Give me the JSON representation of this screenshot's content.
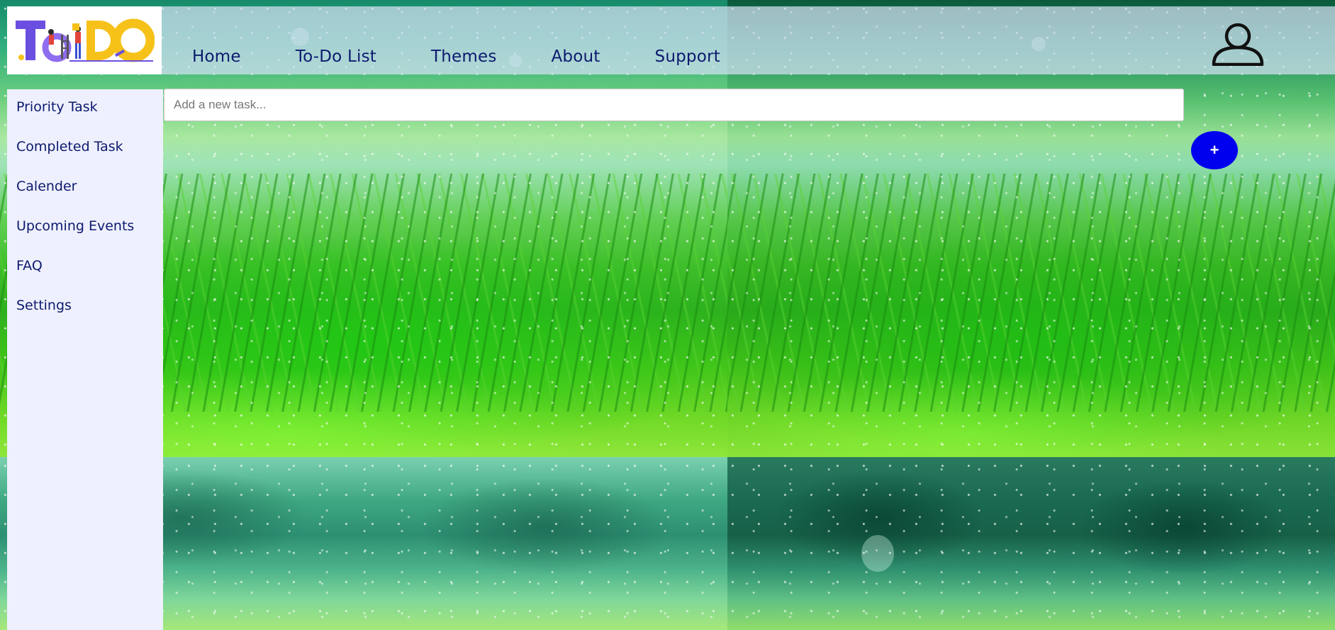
{
  "logo": {
    "text": "ToDo"
  },
  "header": {
    "nav": [
      {
        "label": "Home"
      },
      {
        "label": "To-Do List"
      },
      {
        "label": "Themes"
      },
      {
        "label": "About"
      },
      {
        "label": "Support"
      }
    ]
  },
  "sidebar": {
    "items": [
      {
        "label": "Priority Task"
      },
      {
        "label": "Completed Task"
      },
      {
        "label": "Calender"
      },
      {
        "label": "Upcoming Events"
      },
      {
        "label": "FAQ"
      },
      {
        "label": "Settings"
      }
    ]
  },
  "task": {
    "placeholder": "Add a new task...",
    "value": "",
    "add_label": "+"
  },
  "icons": {
    "profile": "user-profile-icon"
  },
  "colors": {
    "nav_text": "#0d1a6e",
    "add_button": "#0000ee",
    "sidebar_bg": "#eef0fd",
    "logo_purple": "#6b4fe0",
    "logo_yellow": "#f6c21a"
  }
}
